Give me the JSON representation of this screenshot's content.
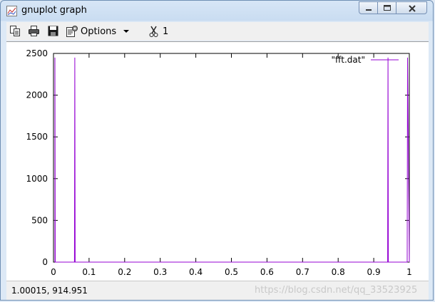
{
  "window": {
    "title": "gnuplot graph"
  },
  "toolbar": {
    "copy_icon": "copy-icon",
    "print_icon": "print-icon",
    "save_icon": "save-icon",
    "options_icon": "options-icon",
    "options_label": "Options",
    "ruler_icon": "scissors-ruler-icon",
    "ruler_label": "1"
  },
  "status": {
    "coords": "1.00015,  914.951",
    "watermark": "https://blog.csdn.net/qq_33523925"
  },
  "colors": {
    "series": "#9400d3",
    "axis": "#000000",
    "background": "#ffffff"
  },
  "chart_data": {
    "type": "line",
    "title": "",
    "xlabel": "",
    "ylabel": "",
    "xlim": [
      0,
      1
    ],
    "ylim": [
      0,
      2500
    ],
    "xticks": [
      "0",
      "0.1",
      "0.2",
      "0.3",
      "0.4",
      "0.5",
      "0.6",
      "0.7",
      "0.8",
      "0.9",
      "1"
    ],
    "yticks": [
      "0",
      "500",
      "1000",
      "1500",
      "2000",
      "2500"
    ],
    "legend": "top-right",
    "grid": false,
    "series": [
      {
        "name": "\"fft.dat\"",
        "points": [
          [
            0.004,
            0
          ],
          [
            0.004,
            2450
          ],
          [
            0.005,
            0
          ],
          [
            0.059,
            0
          ],
          [
            0.06,
            2450
          ],
          [
            0.061,
            0
          ],
          [
            0.939,
            0
          ],
          [
            0.94,
            2450
          ],
          [
            0.941,
            0
          ],
          [
            0.994,
            0
          ],
          [
            0.995,
            2450
          ],
          [
            1.0,
            0
          ]
        ]
      }
    ]
  }
}
